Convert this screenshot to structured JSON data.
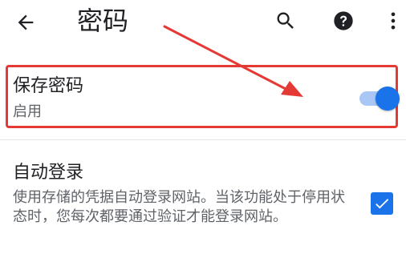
{
  "app_bar": {
    "title": "密码",
    "back_icon": "arrow-left-icon",
    "search_icon": "search-icon",
    "help_icon": "help-icon",
    "more_icon": "more-vert-icon"
  },
  "save_passwords": {
    "title": "保存密码",
    "status": "启用",
    "toggle_on": true
  },
  "auto_sign_in": {
    "title": "自动登录",
    "description": "使用存储的凭据自动登录网站。当该功能处于停用状态时，您每次都要通过验证才能登录网站。",
    "checked": true
  },
  "colors": {
    "accent": "#1a73e8",
    "highlight": "#e53935",
    "primary_text": "#202124",
    "secondary_text": "#5f6368"
  }
}
